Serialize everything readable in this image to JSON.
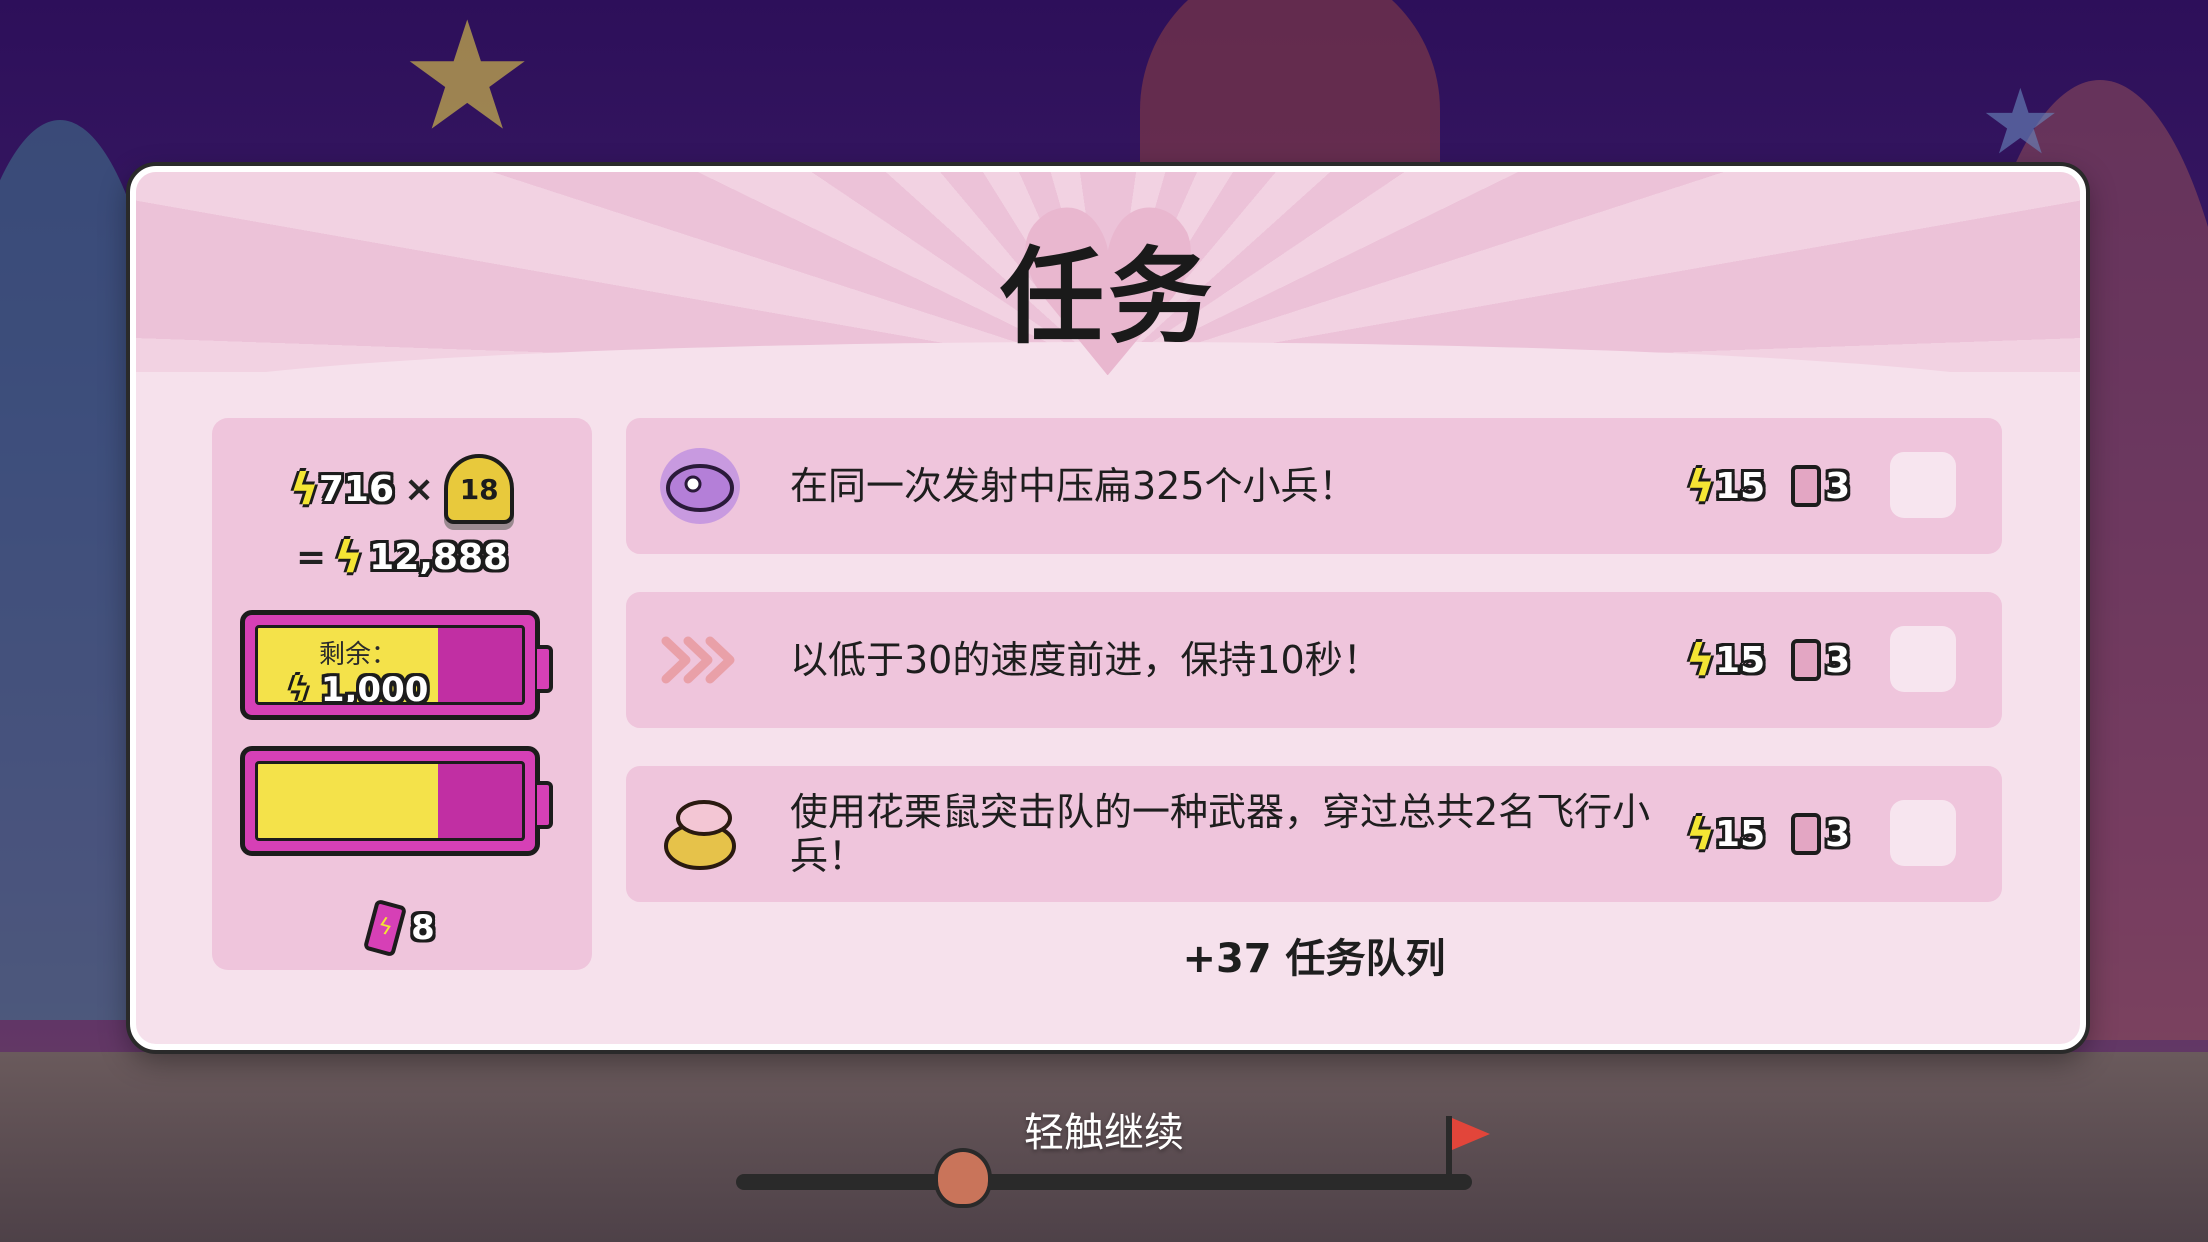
{
  "panel": {
    "title": "任务"
  },
  "stats": {
    "multiplicand": "716",
    "times_sign": "×",
    "level": "18",
    "equals_sign": "=",
    "total": "12,888",
    "remaining_label": "剩余：",
    "remaining_value": "1,000",
    "battery_1_fill": 0.68,
    "battery_2_fill": 0.68,
    "cell_count": "8"
  },
  "missions": [
    {
      "text": "在同一次发射中压扁325个小兵！",
      "reward_energy": "15",
      "reward_cards": "3",
      "icon": "purple-creature-icon"
    },
    {
      "text": "以低于30的速度前进，保持10秒！",
      "reward_energy": "15",
      "reward_cards": "3",
      "icon": "speed-chevrons-icon"
    },
    {
      "text": "使用花栗鼠突击队的一种武器，穿过总共2名飞行小兵！",
      "reward_energy": "15",
      "reward_cards": "3",
      "icon": "chipmunk-icon"
    }
  ],
  "queue_text": "+37 任务队列",
  "footer": {
    "tap_to_continue": "轻触继续"
  },
  "colors": {
    "panel_bg": "#f6e1ec",
    "card_bg": "#efc5dc",
    "energy_yellow": "#f4e534",
    "battery_magenta": "#d640b6"
  }
}
